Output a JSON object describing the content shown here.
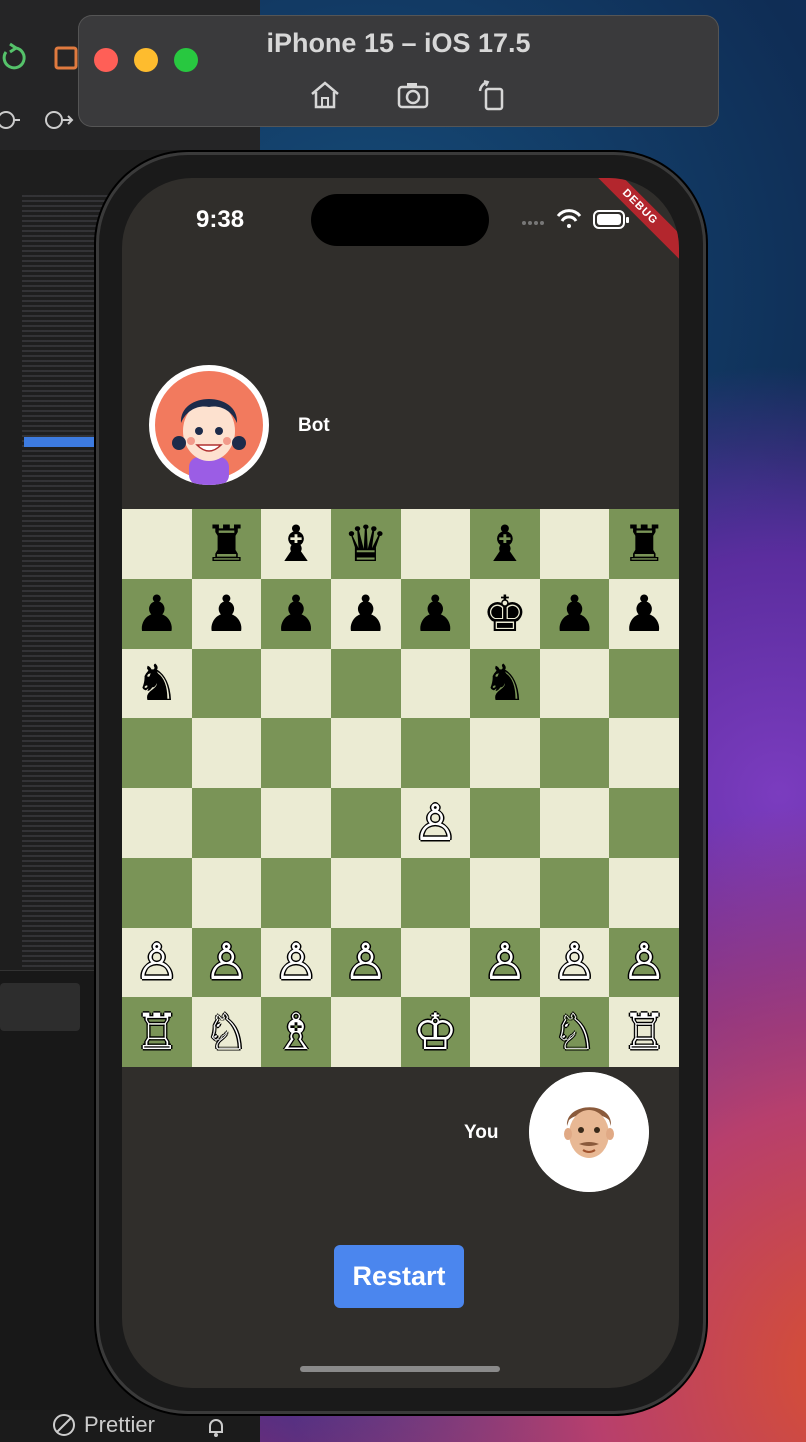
{
  "simulator": {
    "title": "iPhone 15 – iOS 17.5",
    "buttons": [
      "home-icon",
      "screenshot-icon",
      "rotate-icon"
    ],
    "traffic_colors": [
      "#ff5f57",
      "#febc2e",
      "#28c840"
    ]
  },
  "statusbar_device": {
    "time": "9:38",
    "debug_label": "DEBUG"
  },
  "players": {
    "bot": {
      "name": "Bot",
      "avatar": "girl-avatar-icon"
    },
    "you": {
      "name": "You",
      "avatar": "memoji-avatar-icon"
    }
  },
  "board": {
    "light_color": "#ebebd3",
    "dark_color": "#7a9457",
    "rows": [
      [
        "",
        "♜",
        "♝",
        "♛",
        "",
        "♝",
        "",
        "♜"
      ],
      [
        "♟",
        "♟",
        "♟",
        "♟",
        "♟",
        "♚",
        "♟",
        "♟"
      ],
      [
        "♞",
        "",
        "",
        "",
        "",
        "♞",
        "",
        ""
      ],
      [
        "",
        "",
        "",
        "",
        "",
        "",
        "",
        ""
      ],
      [
        "",
        "",
        "",
        "",
        "♙",
        "",
        "",
        ""
      ],
      [
        "",
        "",
        "",
        "",
        "",
        "",
        "",
        ""
      ],
      [
        "♙",
        "♙",
        "♙",
        "♙",
        "",
        "♙",
        "♙",
        "♙"
      ],
      [
        "♖",
        "♘",
        "♗",
        "",
        "♔",
        "",
        "♘",
        "♖"
      ]
    ]
  },
  "actions": {
    "restart_label": "Restart"
  },
  "editor": {
    "prettier_label": "Prettier"
  }
}
